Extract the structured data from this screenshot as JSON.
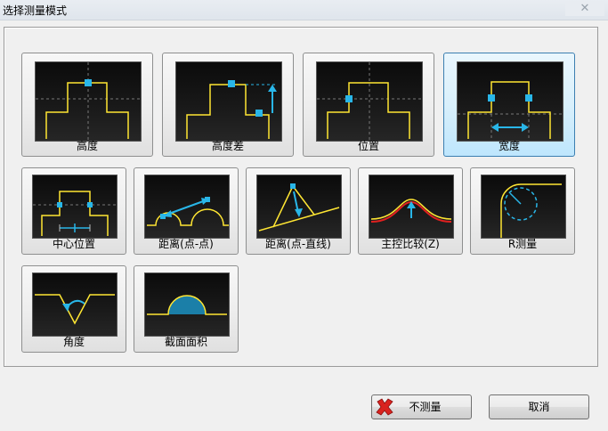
{
  "window": {
    "title": "选择测量模式"
  },
  "modes": [
    {
      "label": "高度"
    },
    {
      "label": "高度差"
    },
    {
      "label": "位置"
    },
    {
      "label": "宽度",
      "selected": true
    },
    {
      "label": "中心位置"
    },
    {
      "label": "距离(点-点)"
    },
    {
      "label": "距离(点-直线)"
    },
    {
      "label": "主控比较(Z)"
    },
    {
      "label": "R测量"
    },
    {
      "label": "角度"
    },
    {
      "label": "截面面积"
    }
  ],
  "buttons": {
    "no_measure": "不测量",
    "cancel": "取消"
  },
  "colors": {
    "profile": "#ffe633",
    "marker": "#29b6e8",
    "selected_bg": "#bee6fd",
    "icon_red": "#d9231f"
  }
}
